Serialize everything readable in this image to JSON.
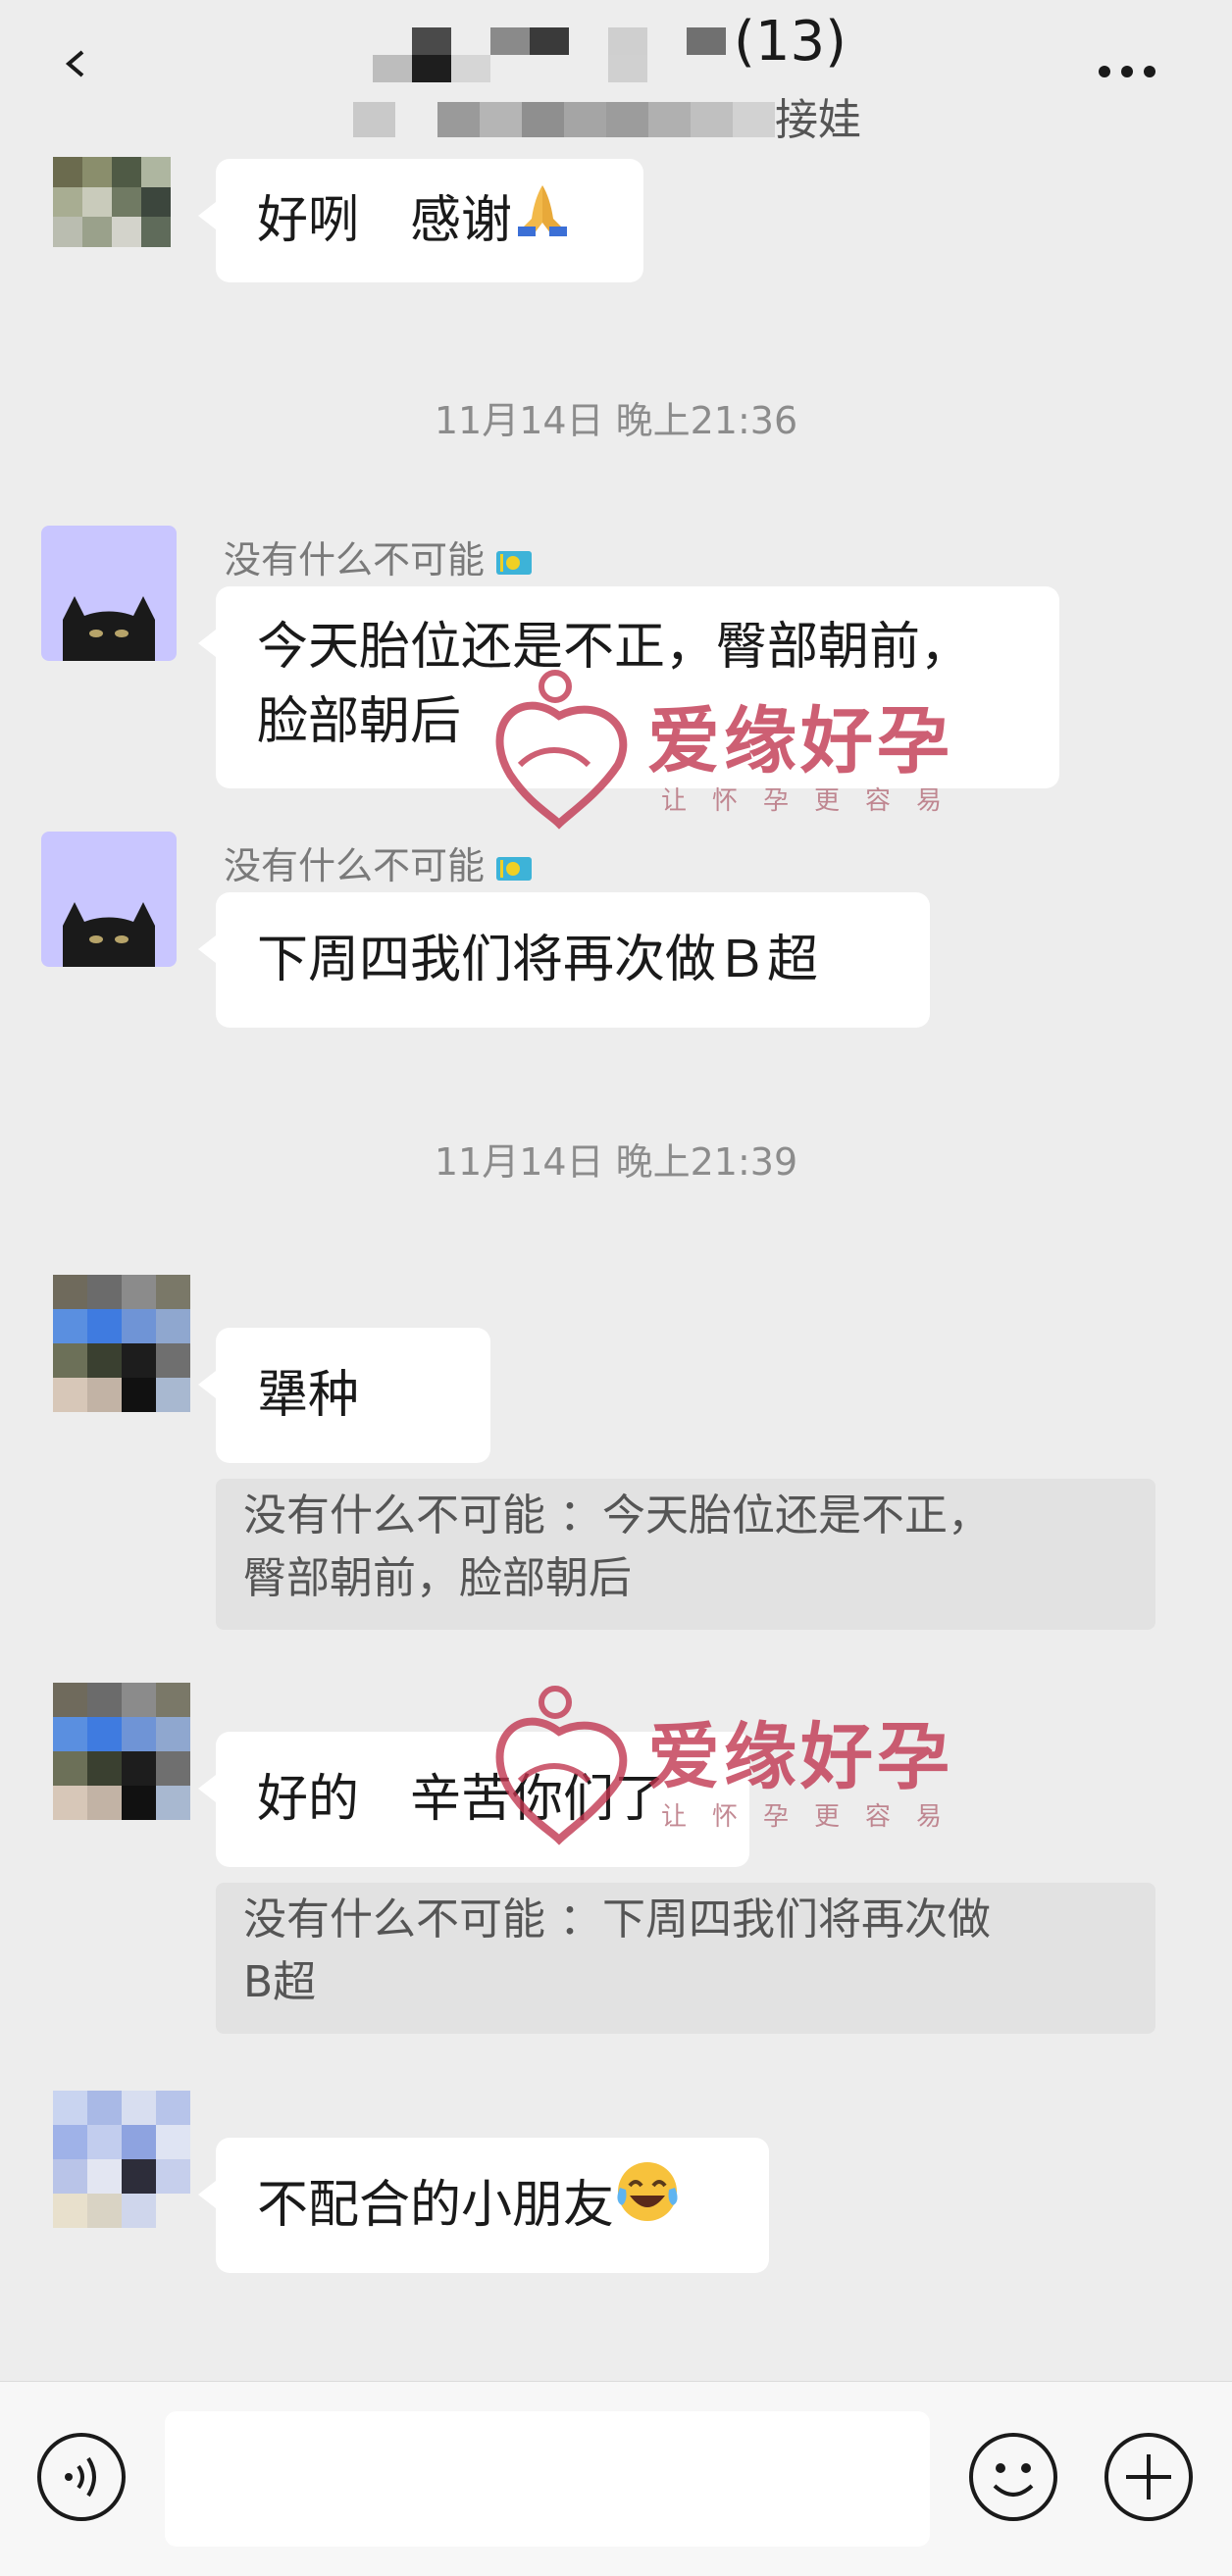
{
  "header": {
    "title_suffix": "(13)",
    "subtitle_tail": "接娃"
  },
  "timestamps": [
    "11月14日 晚上21:36",
    "11月14日 晚上21:39"
  ],
  "messages": [
    {
      "text": "好咧　感谢"
    },
    {
      "sender": "没有什么不可能",
      "text_line1": "今天胎位还是不正，臀部朝前，",
      "text_line2": "脸部朝后"
    },
    {
      "sender": "没有什么不可能",
      "text": "下周四我们将再次做Ｂ超"
    },
    {
      "text": "犟种",
      "quote_line1": "没有什么不可能 ：今天胎位还是不正，",
      "quote_line2": "臀部朝前，脸部朝后"
    },
    {
      "text": "好的　辛苦你们了",
      "quote_line1": "没有什么不可能 ：下周四我们将再次做",
      "quote_line2": "B超"
    },
    {
      "text": "不配合的小朋友"
    }
  ],
  "watermark": {
    "title": "爱缘好孕",
    "subtitle": "让怀孕更容易"
  },
  "icons": {
    "pray": "folded-hands-emoji",
    "laugh": "tears-of-joy-emoji",
    "voice": "voice-icon",
    "emoji": "emoji-icon",
    "plus": "plus-icon",
    "more": "more-icon",
    "back": "back-icon"
  },
  "colors": {
    "background": "#ededed",
    "bubble": "#ffffff",
    "quote": "#e2e2e2",
    "watermark": "#c0334d",
    "cat_avatar_bg": "#c9c6ff"
  }
}
